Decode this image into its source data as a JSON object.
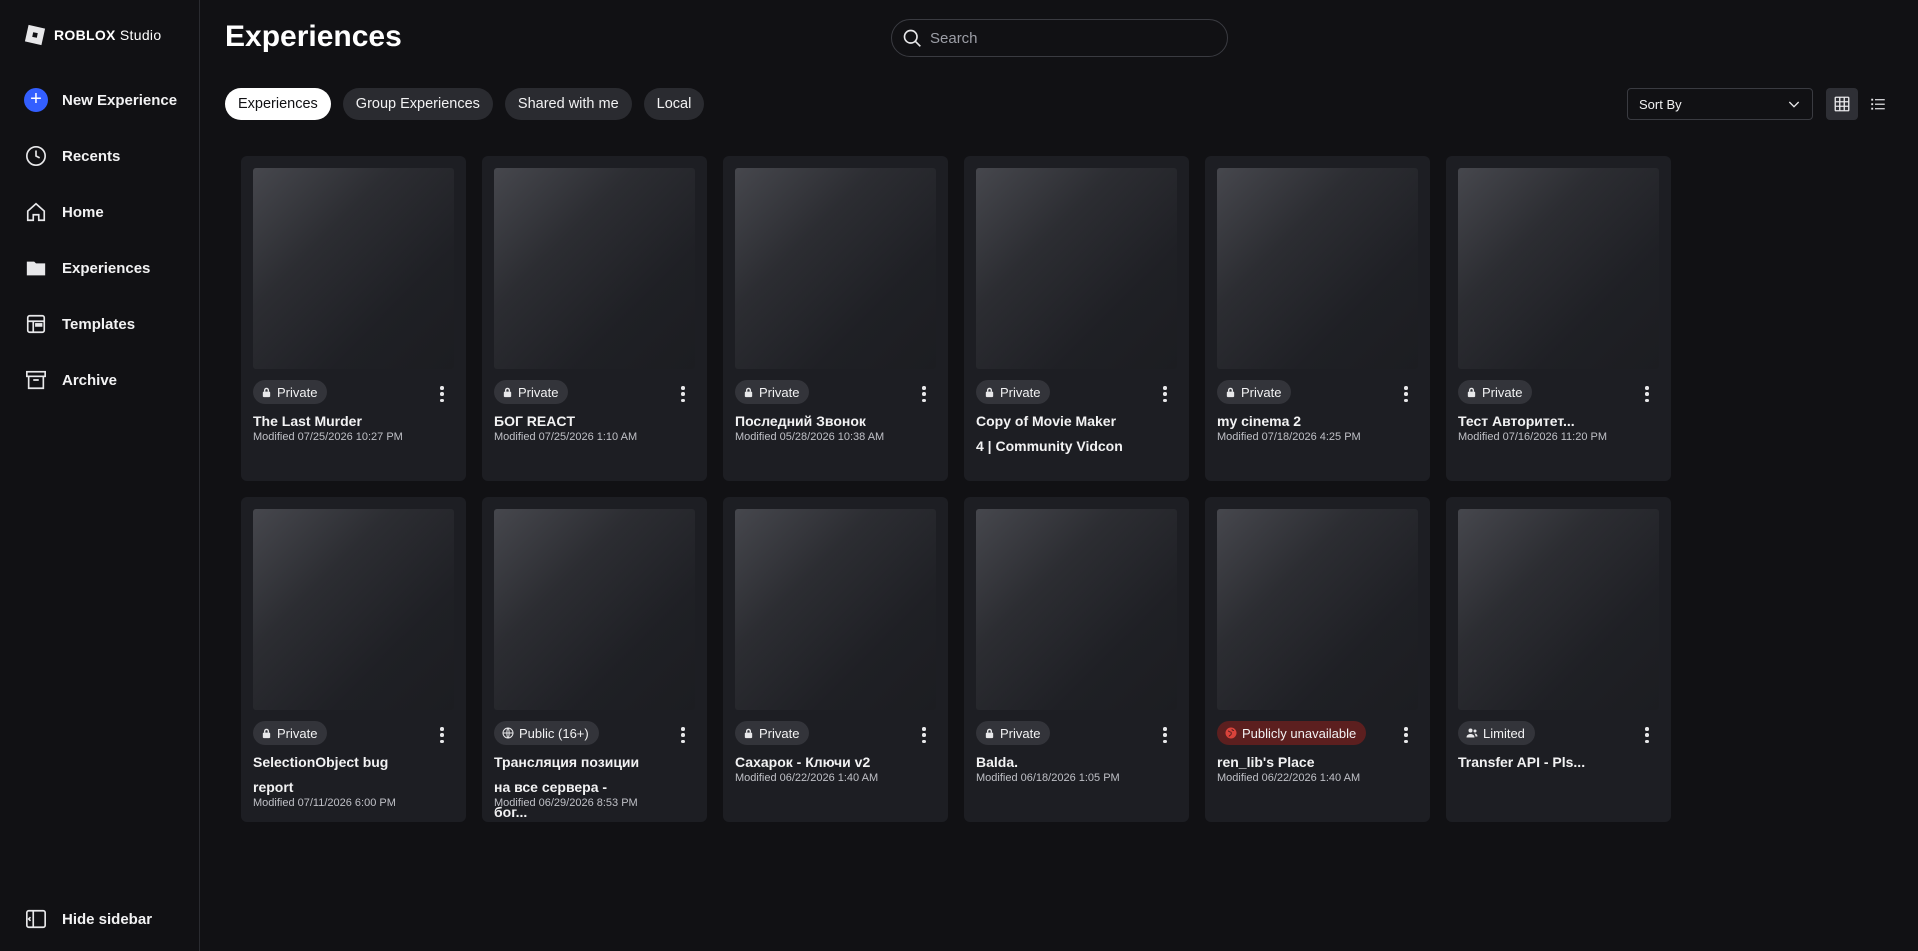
{
  "app": {
    "logo_brand": "ROBLOX",
    "logo_product": "Studio"
  },
  "sidebar": {
    "items": [
      {
        "id": "new",
        "label": "New Experience",
        "icon": "plus-icon"
      },
      {
        "id": "recents",
        "label": "Recents",
        "icon": "clock-icon"
      },
      {
        "id": "home",
        "label": "Home",
        "icon": "home-icon"
      },
      {
        "id": "experiences",
        "label": "Experiences",
        "icon": "folder-icon"
      },
      {
        "id": "templates",
        "label": "Templates",
        "icon": "template-icon"
      },
      {
        "id": "archive",
        "label": "Archive",
        "icon": "archive-icon"
      }
    ],
    "hide_label": "Hide sidebar"
  },
  "header": {
    "title": "Experiences"
  },
  "search": {
    "placeholder": "Search"
  },
  "tabs": [
    {
      "label": "Experiences",
      "active": true
    },
    {
      "label": "Group Experiences",
      "active": false
    },
    {
      "label": "Shared with me",
      "active": false
    },
    {
      "label": "Local",
      "active": false
    }
  ],
  "sort": {
    "label": "Sort By"
  },
  "cards": [
    {
      "badge": "Private",
      "badge_icon": "lock-icon",
      "title": "The Last Murder",
      "modified": "Modified 07/25/2026 10:27 PM"
    },
    {
      "badge": "Private",
      "badge_icon": "lock-icon",
      "title": "БОГ REACT",
      "modified": "Modified 07/25/2026 1:10 AM"
    },
    {
      "badge": "Private",
      "badge_icon": "lock-icon",
      "title": "Последний Звонок",
      "modified": "Modified 05/28/2026 10:38 AM"
    },
    {
      "badge": "Private",
      "badge_icon": "lock-icon",
      "title": "Copy of Movie Maker 4 | Community Vidcon",
      "modified": ""
    },
    {
      "badge": "Private",
      "badge_icon": "lock-icon",
      "title": "my cinema 2",
      "modified": "Modified 07/18/2026 4:25 PM"
    },
    {
      "badge": "Private",
      "badge_icon": "lock-icon",
      "title": "Тест Авторитет...",
      "modified": "Modified 07/16/2026 11:20 PM"
    },
    {
      "badge": "Private",
      "badge_icon": "lock-icon",
      "title": "SelectionObject bug report",
      "modified": "Modified 07/11/2026 6:00 PM"
    },
    {
      "badge": "Public (16+)",
      "badge_icon": "globe-icon",
      "title": "Трансляция позиции на все сервера - бог...",
      "modified": "Modified 06/29/2026 8:53 PM"
    },
    {
      "badge": "Private",
      "badge_icon": "lock-icon",
      "title": "Сахарок - Ключи v2",
      "modified": "Modified 06/22/2026 1:40 AM"
    },
    {
      "badge": "Private",
      "badge_icon": "lock-icon",
      "title": "Balda.",
      "modified": "Modified 06/18/2026 1:05 PM"
    },
    {
      "badge": "Publicly unavailable",
      "badge_icon": "globe-warning-icon",
      "title": "ren_lib's Place",
      "modified": "Modified 06/22/2026 1:40 AM"
    },
    {
      "badge": "Limited",
      "badge_icon": "users-icon",
      "title": "Transfer API - Pls...",
      "modified": ""
    }
  ],
  "colors": {
    "background": "#111114",
    "card": "#1d1e23",
    "accent": "#335fff",
    "warning_badge": "#5c1f1f"
  }
}
